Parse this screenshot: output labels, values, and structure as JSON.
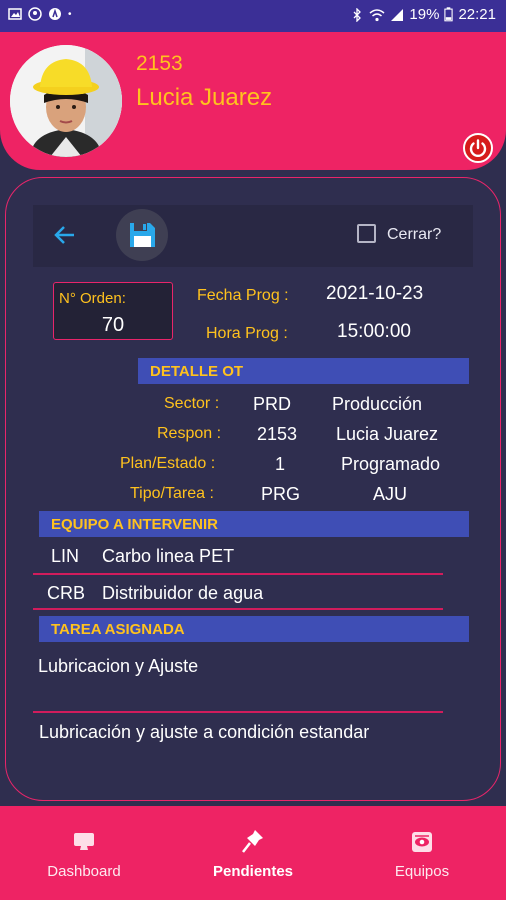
{
  "status_bar": {
    "battery": "19%",
    "time": "22:21"
  },
  "header": {
    "user_id": "2153",
    "user_name": "Lucia Juarez"
  },
  "toolbar": {
    "close_label": "Cerrar?"
  },
  "order": {
    "number_label": "N° Orden:",
    "number": "70",
    "fecha_label": "Fecha Prog :",
    "fecha": "2021-10-23",
    "hora_label": "Hora Prog :",
    "hora": "15:00:00"
  },
  "detalle": {
    "title": "DETALLE OT",
    "rows": [
      {
        "label": "Sector :",
        "code": "PRD",
        "desc": "Producción"
      },
      {
        "label": "Respon :",
        "code": "2153",
        "desc": "Lucia Juarez"
      },
      {
        "label": "Plan/Estado :",
        "code": "1",
        "desc": "Programado"
      },
      {
        "label": "Tipo/Tarea :",
        "code": "PRG",
        "desc": "AJU"
      }
    ]
  },
  "equipo": {
    "title": "EQUIPO A INTERVENIR",
    "items": [
      {
        "code": "LIN",
        "name": "Carbo linea PET"
      },
      {
        "code": "CRB",
        "name": "Distribuidor de agua"
      }
    ]
  },
  "tarea": {
    "title": "TAREA ASIGNADA",
    "name": "Lubricacion y Ajuste",
    "description": "Lubricación y ajuste a condición estandar"
  },
  "nav": {
    "dashboard": "Dashboard",
    "pendientes": "Pendientes",
    "equipos": "Equipos"
  },
  "colors": {
    "accent_pink": "#ee2364",
    "label_yellow": "#ffc21e",
    "band_blue": "#3f4eb5",
    "background": "#2f2e4f"
  }
}
